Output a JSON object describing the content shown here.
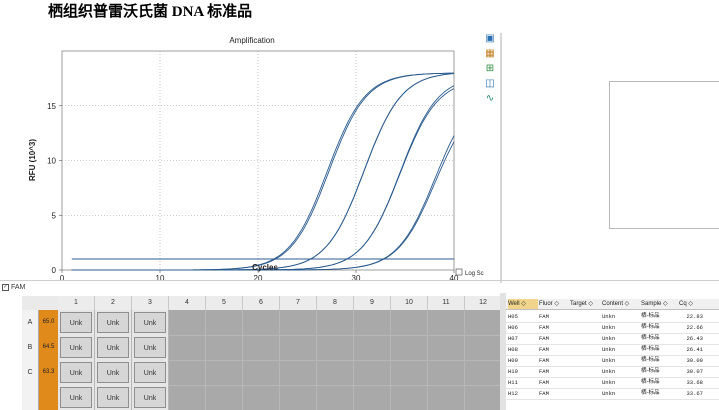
{
  "page_title": "栖组织普雷沃氏菌 DNA 标准品",
  "chart": {
    "title": "Amplification",
    "xlabel": "Cycles",
    "ylabel": "RFU (10^3)",
    "log_scale_label": "Log Scale",
    "log_scale_checked": false,
    "line_color": "#2b5b8e"
  },
  "chart_data": {
    "type": "line",
    "title": "Amplification",
    "xlabel": "Cycles",
    "ylabel": "RFU (10^3)",
    "xlim": [
      0,
      40
    ],
    "ylim": [
      0,
      20
    ],
    "xticks": [
      0,
      10,
      20,
      30,
      40
    ],
    "yticks": [
      0,
      5,
      10,
      15
    ],
    "grid": true,
    "threshold": 1.0,
    "series": [
      {
        "well": "H05",
        "cq": 22.83,
        "plateau": 18.0
      },
      {
        "well": "H06",
        "cq": 22.66,
        "plateau": 18.0
      },
      {
        "well": "H07",
        "cq": 26.43,
        "plateau": 18.1
      },
      {
        "well": "H08",
        "cq": 26.41,
        "plateau": 18.1
      },
      {
        "well": "H09",
        "cq": 30.09,
        "plateau": 17.8
      },
      {
        "well": "H10",
        "cq": 30.07,
        "plateau": 17.5
      },
      {
        "well": "H11",
        "cq": 33.68,
        "plateau": 16.8
      },
      {
        "well": "H12",
        "cq": 33.67,
        "plateau": 16.0
      }
    ]
  },
  "toolbar_icons": [
    "copy-icon",
    "chart-settings-icon",
    "export-icon",
    "zoom-icon",
    "trace-icon"
  ],
  "fluor_filter": {
    "label": "FAM",
    "checked": true
  },
  "plate": {
    "columns": [
      "1",
      "2",
      "3",
      "4",
      "5",
      "6",
      "7",
      "8",
      "9",
      "10",
      "11",
      "12"
    ],
    "rows": [
      {
        "label": "A",
        "tm": "65.0",
        "wells": [
          "Unk",
          "Unk",
          "Unk"
        ]
      },
      {
        "label": "B",
        "tm": "64.5",
        "wells": [
          "Unk",
          "Unk",
          "Unk"
        ]
      },
      {
        "label": "C",
        "tm": "63.3",
        "wells": [
          "Unk",
          "Unk",
          "Unk"
        ]
      },
      {
        "label": "",
        "tm": "",
        "wells": [
          "Unk",
          "Unk",
          "Unk"
        ]
      }
    ]
  },
  "table": {
    "headers": [
      "Well",
      "Fluor",
      "Target",
      "Content",
      "Sample",
      "Cq"
    ],
    "rows": [
      [
        "H05",
        "FAM",
        "",
        "Unkn",
        "栖-标品",
        "22.83"
      ],
      [
        "H06",
        "FAM",
        "",
        "Unkn",
        "栖-标品",
        "22.66"
      ],
      [
        "H07",
        "FAM",
        "",
        "Unkn",
        "栖-标品",
        "26.43"
      ],
      [
        "H08",
        "FAM",
        "",
        "Unkn",
        "栖-标品",
        "26.41"
      ],
      [
        "H09",
        "FAM",
        "",
        "Unkn",
        "栖-标品",
        "30.09"
      ],
      [
        "H10",
        "FAM",
        "",
        "Unkn",
        "栖-标品",
        "30.07"
      ],
      [
        "H11",
        "FAM",
        "",
        "Unkn",
        "栖-标品",
        "33.68"
      ],
      [
        "H12",
        "FAM",
        "",
        "Unkn",
        "栖-标品",
        "33.67"
      ]
    ]
  }
}
